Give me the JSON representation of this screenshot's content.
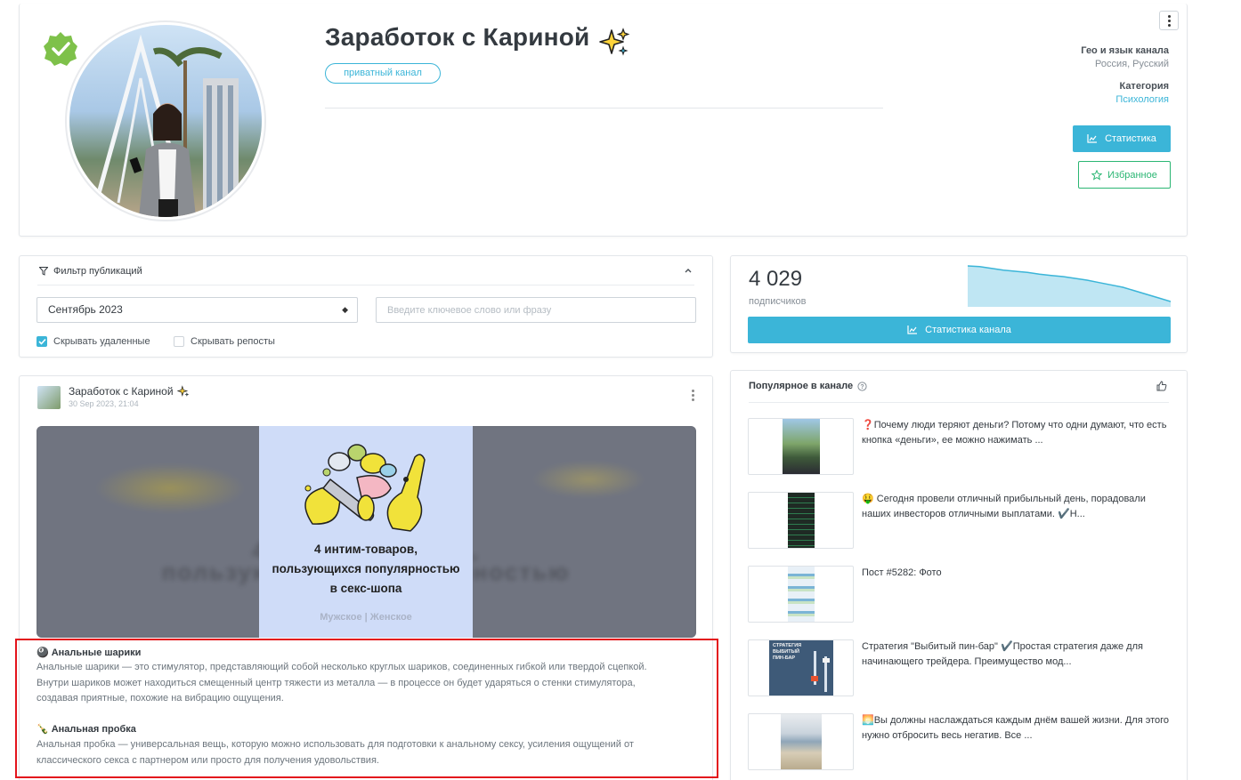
{
  "channel": {
    "title": "Заработок с Кариной",
    "title_emoji": "✨",
    "private_badge": "приватный канал",
    "geo_label": "Гео и язык канала",
    "geo_value": "Россия, Русский",
    "category_label": "Категория",
    "category_value": "Психология",
    "stats_button": "Статистика",
    "favorite_button": "Избранное"
  },
  "filter": {
    "title": "Фильтр публикаций",
    "month_select": "Сентябрь 2023",
    "search_placeholder": "Введите ключевое слово или фразу",
    "hide_deleted_label": "Скрывать удаленные",
    "hide_deleted_checked": true,
    "hide_reposts_label": "Скрывать репосты",
    "hide_reposts_checked": false
  },
  "post": {
    "author": "Заработок с Кариной",
    "author_emoji": "✨",
    "date": "30 Sep 2023, 21:04",
    "media_caption_lines": [
      "4 интим-товаров,",
      "пользующихся популярностью",
      "в секс-шопа"
    ],
    "media_watermark": "Мужское | Женское",
    "section1_emoji": "🎱",
    "section1_title": "Анальные шарики",
    "section1_text": "Анальные шарики — это стимулятор, представляющий собой несколько круглых шариков, соединенных гибкой или твердой сцепкой. Внутри шариков может находиться смещенный центр тяжести из металла — в процессе он будет ударяться о стенки стимулятора, создавая приятные, похожие на вибрацию ощущения.",
    "section2_emoji": "🍾",
    "section2_title": "Анальная пробка",
    "section2_text": "Анальная пробка — универсальная вещь, которую можно использовать для подготовки к анальному сексу, усиления ощущений от классического секса с партнером или просто для получения удовольствия."
  },
  "stats": {
    "subscribers": "4 029",
    "subscribers_label": "подписчиков",
    "channel_stats_button": "Статистика канала",
    "sparkline_values": [
      100,
      99,
      96,
      93,
      91,
      89,
      86,
      84,
      82,
      79,
      76,
      72,
      68,
      64,
      58,
      52,
      46,
      40
    ]
  },
  "popular": {
    "title": "Популярное в канале",
    "items": [
      {
        "text": "❓Почему люди теряют деньги? Потому что одни думают, что есть кнопка «деньги», ее можно нажимать ..."
      },
      {
        "text": "🤑 Сегодня провели отличный прибыльный день, порадовали наших инвесторов отличными выплатами. ✔️Н..."
      },
      {
        "text": "Пост #5282: Фото"
      },
      {
        "text": "Стратегия \"Выбитый пин-бар\" ✔️Простая стратегия даже для начинающего трейдера. Преимущество мод..."
      },
      {
        "text": "🌅Вы должны наслаждаться каждым днём вашей жизни. Для этого нужно отбросить весь негатив. Все ..."
      }
    ],
    "thumb4_caption": "СТРАТЕГИЯ ВЫБИТЫЙ ПИН-БАР"
  },
  "colors": {
    "accent": "#3bb5d8",
    "favorite": "#2bb673",
    "highlight": "#e3141c",
    "verified": "#7ec14a"
  }
}
